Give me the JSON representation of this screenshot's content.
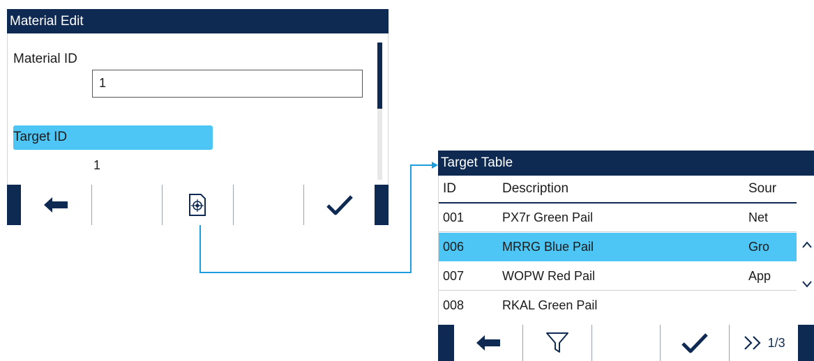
{
  "material_edit": {
    "title": "Material Edit",
    "material_id_label": "Material ID",
    "material_id_value": "1",
    "target_id_label": "Target ID",
    "target_id_value": "1",
    "softkeys": [
      "back-arrow-icon",
      "empty",
      "target-table-icon",
      "empty",
      "check-icon"
    ]
  },
  "target_table": {
    "title": "Target Table",
    "columns": [
      "ID",
      "Description",
      "Sour"
    ],
    "rows": [
      {
        "id": "001",
        "description": "PX7r Green Pail",
        "source": "Net"
      },
      {
        "id": "006",
        "description": "MRRG Blue Pail",
        "source": "Gro",
        "selected": true
      },
      {
        "id": "007",
        "description": "WOPW Red Pail",
        "source": "App"
      },
      {
        "id": "008",
        "description": "RKAL Green Pail",
        "source": ""
      }
    ],
    "page_indicator": "1/3",
    "softkeys": [
      "back-arrow-icon",
      "filter-icon",
      "empty",
      "check-icon",
      "next-page-icon"
    ]
  },
  "colors": {
    "header": "#0f2a52",
    "highlight": "#4dc6f5",
    "connector": "#1a9ee0"
  }
}
